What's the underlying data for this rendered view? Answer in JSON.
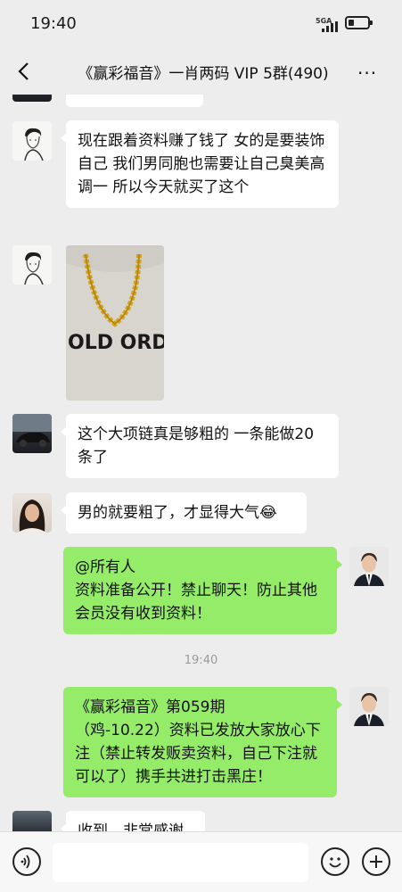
{
  "status_bar": {
    "time": "19:40",
    "network": "5GA",
    "battery_level": 0.3
  },
  "nav": {
    "title": "《赢彩福音》一肖两码 VIP 5群(490)",
    "back_icon": "chevron-left-icon",
    "more_icon": "more-dots-icon",
    "more_glyph": "···"
  },
  "messages": [
    {
      "side": "left",
      "text": "现在跟着资料赚了钱了 女的是要装饰自己 我们男同胞也需要让自己臭美高调一 所以今天就买了这个"
    },
    {
      "side": "left",
      "type": "image",
      "image_text": "OLD ORDE"
    },
    {
      "side": "left",
      "text": "这个大项链真是够粗的 一条能做20条了"
    },
    {
      "side": "left",
      "text": "男的就要粗了，才显得大气😂"
    },
    {
      "side": "right",
      "lines": [
        "@所有人",
        "资料准备公开！禁止聊天！防止其他会员没有收到资料！"
      ]
    },
    {
      "side": "right",
      "lines": [
        "《赢彩福音》第059期",
        "（鸡-10.22）资料已发放大家放心下注（禁止转发贩卖资料，自己下注就可以了）携手共进打击黑庄！"
      ]
    },
    {
      "side": "left",
      "text": "收到，非常感谢"
    }
  ],
  "timestamp": "19:40",
  "input_bar": {
    "voice_icon": "voice-icon",
    "emoji_icon": "emoji-icon",
    "plus_icon": "plus-icon",
    "placeholder": ""
  }
}
